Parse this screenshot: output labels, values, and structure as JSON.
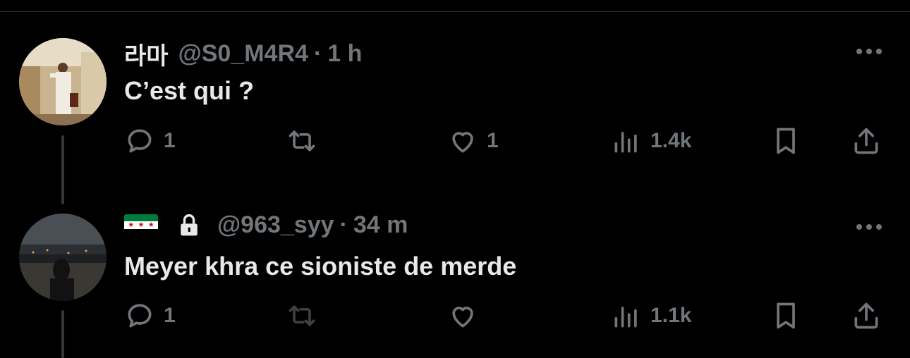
{
  "tweets": [
    {
      "display_name": "라마",
      "handle": "@S0_M4R4",
      "separator": "·",
      "time": "1 h",
      "text": "C’est qui ?",
      "reply_count": "1",
      "retweet_count": "",
      "like_count": "1",
      "view_count": "1.4k"
    },
    {
      "display_name_icons": [
        "syrian-flag-icon",
        "lock-icon"
      ],
      "handle": "@963_syy",
      "separator": "·",
      "time": "34 m",
      "text": "Meyer khra ce sioniste de merde",
      "reply_count": "1",
      "retweet_count": "",
      "like_count": "",
      "view_count": "1.1k"
    }
  ],
  "colors": {
    "background": "#000000",
    "primary_text": "#e7e9ea",
    "secondary_text": "#71767b",
    "thread_line": "#333639",
    "flag_green": "#007a3d",
    "flag_white": "#ffffff",
    "flag_black": "#000000",
    "flag_star": "#ce1126"
  }
}
